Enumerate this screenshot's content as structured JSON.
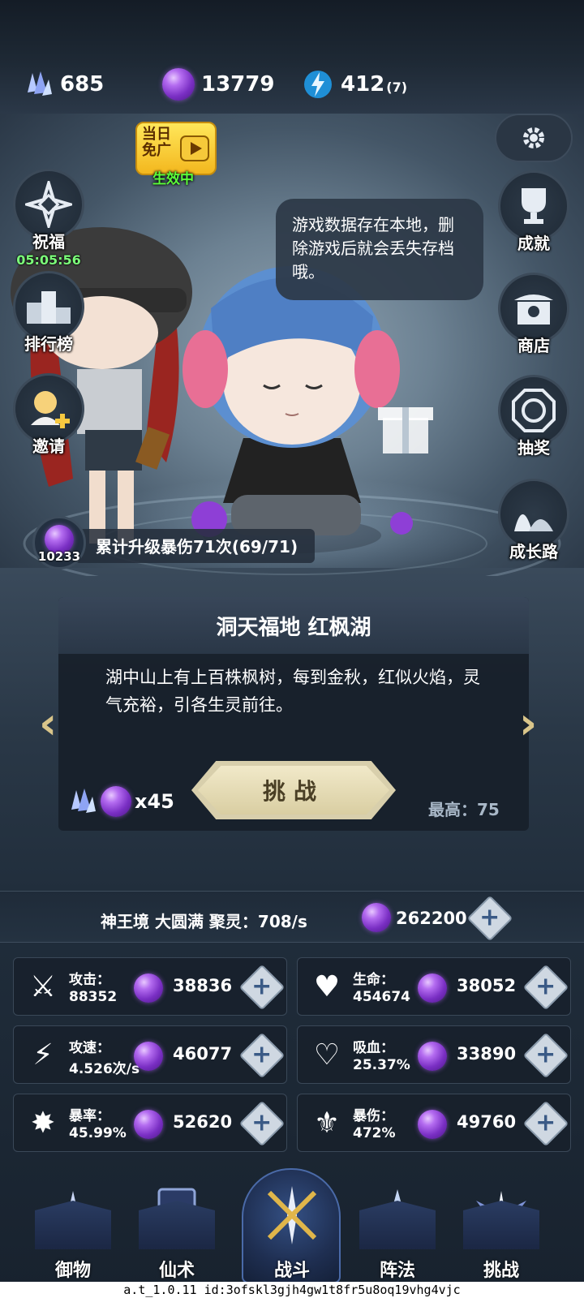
{
  "currencies": [
    {
      "name": "crystal",
      "icon": "crystal-icon",
      "value": "685"
    },
    {
      "name": "spirit-orb",
      "icon": "purple-orb-icon",
      "value": "13779"
    },
    {
      "name": "energy",
      "icon": "energy-crystal-icon",
      "value": "412",
      "sub": "(7)"
    }
  ],
  "promo": {
    "label_line1": "当日",
    "label_line2": "免广",
    "status": "生效中"
  },
  "left_menu": {
    "blessing": {
      "label": "祝福",
      "timer": "05:05:56"
    },
    "ranking": {
      "label": "排行榜"
    },
    "invite": {
      "label": "邀请"
    }
  },
  "right_menu": {
    "achievement": {
      "label": "成就"
    },
    "shop": {
      "label": "商店"
    },
    "lottery": {
      "label": "抽奖"
    },
    "growth": {
      "label": "成长路"
    }
  },
  "bubble": {
    "text": "游戏数据存在本地，删除游戏后就会丢失存档哦。"
  },
  "upgrade": {
    "count": "10233",
    "text": "累计升级暴伤71次(69/71)"
  },
  "stage": {
    "title": "洞天福地 红枫湖",
    "description": "湖中山上有上百株枫树，每到金秋，红似火焰，灵气充裕，引各生灵前往。",
    "challenge_label": "挑战",
    "cost": "x45",
    "best_label": "最高：",
    "best_value": "75"
  },
  "realm": {
    "text": "神王境 大圆满 聚灵：708/s",
    "orbs": "262200"
  },
  "stats": [
    {
      "name": "攻击：",
      "value": "88352",
      "cost": "38836",
      "icon": "sword-icon"
    },
    {
      "name": "生命：",
      "value": "454674",
      "cost": "38052",
      "icon": "heart-icon"
    },
    {
      "name": "攻速：",
      "value": "4.526次/s",
      "cost": "46077",
      "icon": "swift-blades-icon"
    },
    {
      "name": "吸血：",
      "value": "25.37%",
      "cost": "33890",
      "icon": "lifesteal-heart-icon"
    },
    {
      "name": "暴率：",
      "value": "45.99%",
      "cost": "52620",
      "icon": "crit-burst-icon"
    },
    {
      "name": "暴伤：",
      "value": "472%",
      "cost": "49760",
      "icon": "crit-damage-icon"
    }
  ],
  "nav": [
    {
      "label": "御物",
      "icon": "sword-crest-icon"
    },
    {
      "label": "仙术",
      "icon": "spell-card-icon"
    },
    {
      "label": "战斗",
      "icon": "battle-emblem-icon",
      "active": true
    },
    {
      "label": "阵法",
      "icon": "formation-star-icon"
    },
    {
      "label": "挑战",
      "icon": "challenge-wings-icon"
    }
  ],
  "build_info": "a.t_1.0.11 id:3ofskl3gjh4gw1t8fr5u8oq19vhg4vjc",
  "colors": {
    "accent_gold": "#d8cfac",
    "timer_green": "#7cff7a",
    "orb_purple": "#9b4fe0",
    "promo_yellow": "#ffe75a"
  }
}
